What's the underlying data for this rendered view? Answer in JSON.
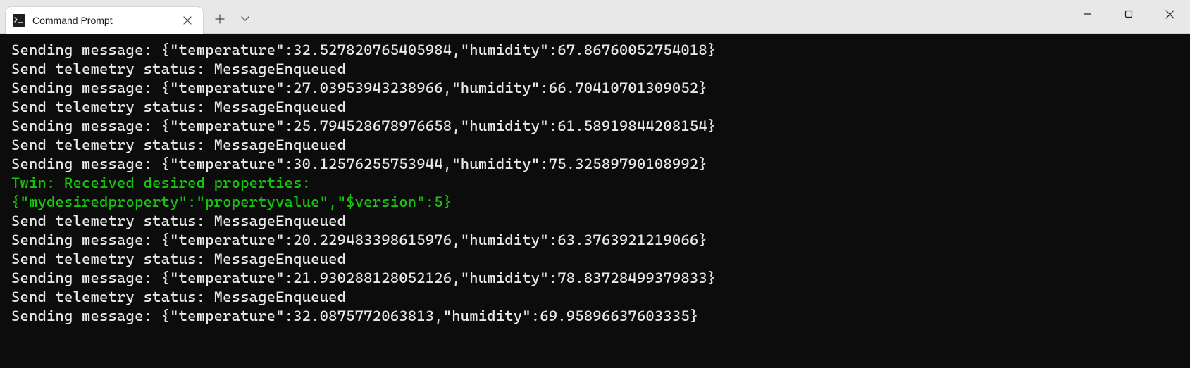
{
  "colors": {
    "terminal_bg": "#0c0c0c",
    "terminal_fg": "#e8e8e8",
    "accent_green": "#16c60c",
    "titlebar_bg": "#e8e8e8",
    "tab_bg": "#ffffff"
  },
  "window": {
    "tab_title": "Command Prompt"
  },
  "terminal": {
    "lines": [
      {
        "text": "Sending message: {\"temperature\":32.527820765405984,\"humidity\":67.86760052754018}",
        "color": "default"
      },
      {
        "text": "Send telemetry status: MessageEnqueued",
        "color": "default"
      },
      {
        "text": "Sending message: {\"temperature\":27.03953943238966,\"humidity\":66.70410701309052}",
        "color": "default"
      },
      {
        "text": "Send telemetry status: MessageEnqueued",
        "color": "default"
      },
      {
        "text": "Sending message: {\"temperature\":25.794528678976658,\"humidity\":61.58919844208154}",
        "color": "default"
      },
      {
        "text": "Send telemetry status: MessageEnqueued",
        "color": "default"
      },
      {
        "text": "Sending message: {\"temperature\":30.12576255753944,\"humidity\":75.32589790108992}",
        "color": "default"
      },
      {
        "text": "Twin: Received desired properties:",
        "color": "green"
      },
      {
        "text": "{\"mydesiredproperty\":\"propertyvalue\",\"$version\":5}",
        "color": "green"
      },
      {
        "text": "Send telemetry status: MessageEnqueued",
        "color": "default"
      },
      {
        "text": "Sending message: {\"temperature\":20.229483398615976,\"humidity\":63.3763921219066}",
        "color": "default"
      },
      {
        "text": "Send telemetry status: MessageEnqueued",
        "color": "default"
      },
      {
        "text": "Sending message: {\"temperature\":21.930288128052126,\"humidity\":78.83728499379833}",
        "color": "default"
      },
      {
        "text": "Send telemetry status: MessageEnqueued",
        "color": "default"
      },
      {
        "text": "Sending message: {\"temperature\":32.0875772063813,\"humidity\":69.95896637603335}",
        "color": "default"
      }
    ]
  }
}
